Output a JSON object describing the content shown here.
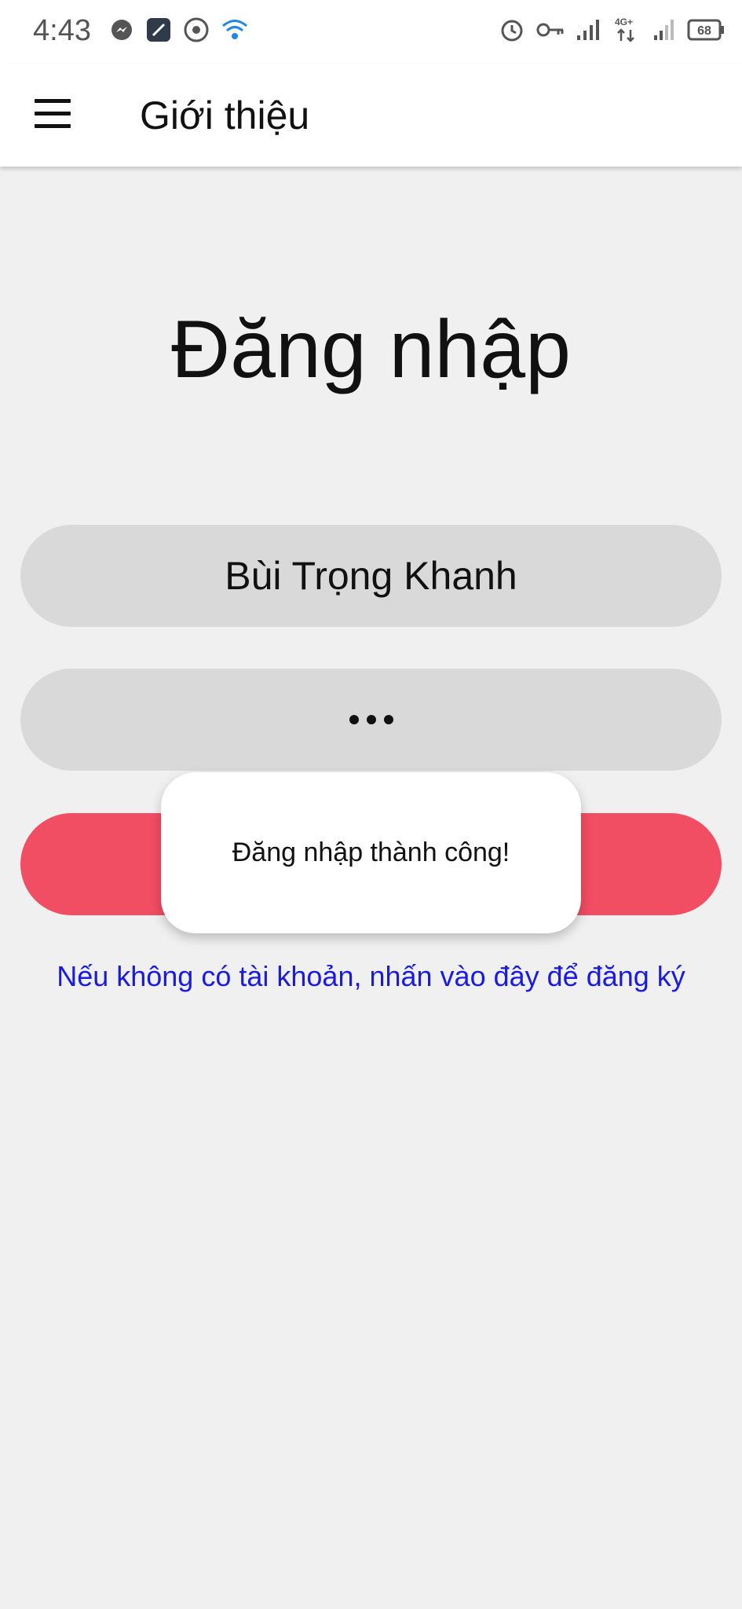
{
  "status_bar": {
    "time": "4:43",
    "battery": "68",
    "network": "4G+",
    "left_icons": [
      "messenger-icon",
      "app-icon",
      "chrome-icon",
      "wifi-icon"
    ],
    "right_icons": [
      "alarm-icon",
      "vpn-key-icon",
      "signal-icon",
      "signal-4g-icon",
      "signal-icon-2",
      "battery-icon"
    ]
  },
  "toolbar": {
    "title": "Giới thiệu",
    "menu_icon": "hamburger-menu-icon"
  },
  "login": {
    "heading": "Đăng nhập",
    "username_value": "Bùi Trọng Khanh",
    "password_mask_count": 3,
    "button_color": "#f14d63",
    "register_link": "Nếu không có tài khoản, nhấn vào đây để đăng ký",
    "link_color": "#1a1ae6"
  },
  "toast": {
    "message": "Đăng nhập thành công!"
  }
}
